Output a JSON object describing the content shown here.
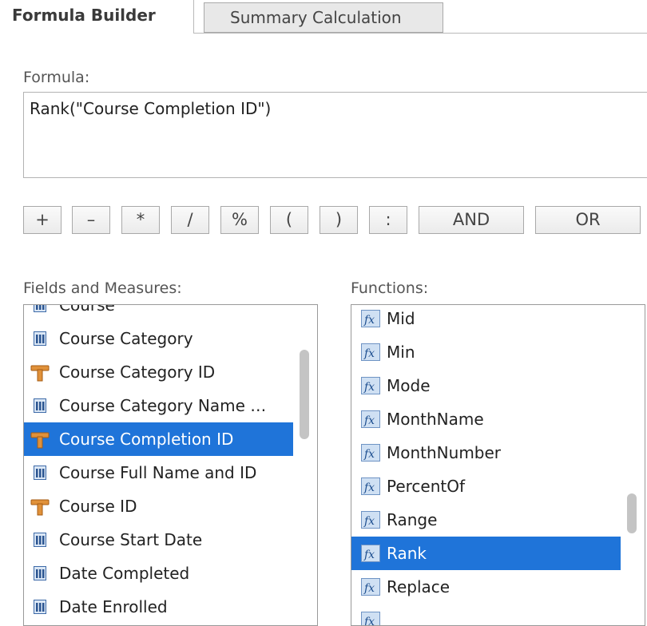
{
  "tabs": {
    "builder": "Formula Builder",
    "summary": "Summary Calculation"
  },
  "formula": {
    "label": "Formula:",
    "value": "Rank(\"Course Completion ID\")"
  },
  "operators": [
    "+",
    "–",
    "*",
    "/",
    "%",
    "(",
    ")",
    ":",
    "AND",
    "OR"
  ],
  "fields": {
    "label": "Fields and Measures:",
    "items": [
      {
        "label": "Course",
        "icon": "measure-icon"
      },
      {
        "label": "Course Category",
        "icon": "measure-icon"
      },
      {
        "label": "Course Category ID",
        "icon": "dimension-icon"
      },
      {
        "label": "Course Category Name …",
        "icon": "measure-icon"
      },
      {
        "label": "Course Completion ID",
        "icon": "dimension-icon",
        "selected": true
      },
      {
        "label": "Course Full Name and ID",
        "icon": "measure-icon"
      },
      {
        "label": "Course ID",
        "icon": "dimension-icon"
      },
      {
        "label": "Course Start Date",
        "icon": "measure-icon"
      },
      {
        "label": "Date Completed",
        "icon": "measure-icon"
      },
      {
        "label": "Date Enrolled",
        "icon": "measure-icon"
      }
    ]
  },
  "functions": {
    "label": "Functions:",
    "items": [
      {
        "label": "Mid",
        "icon": "fx-icon"
      },
      {
        "label": "Min",
        "icon": "fx-icon"
      },
      {
        "label": "Mode",
        "icon": "fx-icon"
      },
      {
        "label": "MonthName",
        "icon": "fx-icon"
      },
      {
        "label": "MonthNumber",
        "icon": "fx-icon"
      },
      {
        "label": "PercentOf",
        "icon": "fx-icon"
      },
      {
        "label": "Range",
        "icon": "fx-icon"
      },
      {
        "label": "Rank",
        "icon": "fx-icon",
        "selected": true
      },
      {
        "label": "Replace",
        "icon": "fx-icon"
      },
      {
        "label": "",
        "icon": "fx-icon"
      }
    ]
  },
  "colors": {
    "selection": "#1f74d9"
  }
}
